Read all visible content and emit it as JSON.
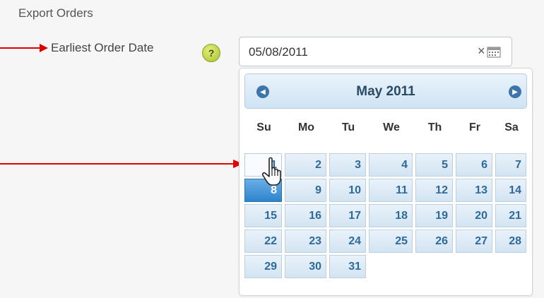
{
  "section": {
    "title": "Export Orders"
  },
  "field": {
    "label": "Earliest Order Date",
    "help_icon": "question-mark-icon",
    "help_glyph": "?",
    "value": "05/08/2011",
    "clear_glyph": "×",
    "calendar_icon": "calendar-icon"
  },
  "calendar": {
    "month_title": "May 2011",
    "prev_icon": "chevron-left-icon",
    "next_icon": "chevron-right-icon",
    "weekdays": [
      "Su",
      "Mo",
      "Tu",
      "We",
      "Th",
      "Fr",
      "Sa"
    ],
    "weeks": [
      [
        "1",
        "2",
        "3",
        "4",
        "5",
        "6",
        "7"
      ],
      [
        "8",
        "9",
        "10",
        "11",
        "12",
        "13",
        "14"
      ],
      [
        "15",
        "16",
        "17",
        "18",
        "19",
        "20",
        "21"
      ],
      [
        "22",
        "23",
        "24",
        "25",
        "26",
        "27",
        "28"
      ],
      [
        "29",
        "30",
        "31"
      ]
    ],
    "selected_day": "8",
    "hovered_day": "1"
  },
  "colors": {
    "annotation_arrow": "#e00000",
    "selected_day": "#2d84cc",
    "day_text": "#2d6a9c"
  }
}
